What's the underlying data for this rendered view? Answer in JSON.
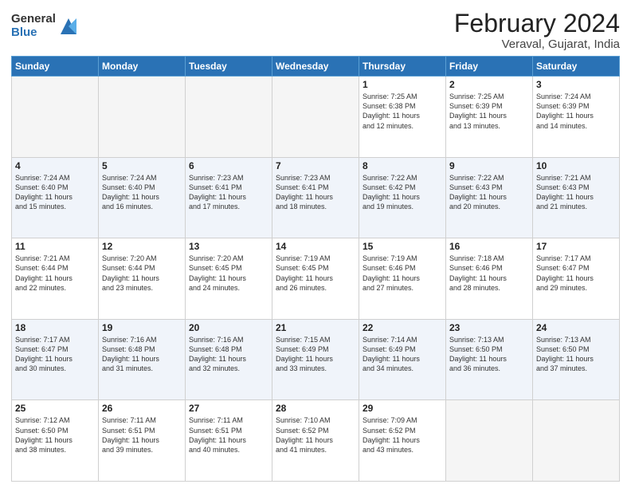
{
  "header": {
    "logo_general": "General",
    "logo_blue": "Blue",
    "month_title": "February 2024",
    "location": "Veraval, Gujarat, India"
  },
  "days_of_week": [
    "Sunday",
    "Monday",
    "Tuesday",
    "Wednesday",
    "Thursday",
    "Friday",
    "Saturday"
  ],
  "weeks": [
    [
      {
        "day": "",
        "info": ""
      },
      {
        "day": "",
        "info": ""
      },
      {
        "day": "",
        "info": ""
      },
      {
        "day": "",
        "info": ""
      },
      {
        "day": "1",
        "info": "Sunrise: 7:25 AM\nSunset: 6:38 PM\nDaylight: 11 hours\nand 12 minutes."
      },
      {
        "day": "2",
        "info": "Sunrise: 7:25 AM\nSunset: 6:39 PM\nDaylight: 11 hours\nand 13 minutes."
      },
      {
        "day": "3",
        "info": "Sunrise: 7:24 AM\nSunset: 6:39 PM\nDaylight: 11 hours\nand 14 minutes."
      }
    ],
    [
      {
        "day": "4",
        "info": "Sunrise: 7:24 AM\nSunset: 6:40 PM\nDaylight: 11 hours\nand 15 minutes."
      },
      {
        "day": "5",
        "info": "Sunrise: 7:24 AM\nSunset: 6:40 PM\nDaylight: 11 hours\nand 16 minutes."
      },
      {
        "day": "6",
        "info": "Sunrise: 7:23 AM\nSunset: 6:41 PM\nDaylight: 11 hours\nand 17 minutes."
      },
      {
        "day": "7",
        "info": "Sunrise: 7:23 AM\nSunset: 6:41 PM\nDaylight: 11 hours\nand 18 minutes."
      },
      {
        "day": "8",
        "info": "Sunrise: 7:22 AM\nSunset: 6:42 PM\nDaylight: 11 hours\nand 19 minutes."
      },
      {
        "day": "9",
        "info": "Sunrise: 7:22 AM\nSunset: 6:43 PM\nDaylight: 11 hours\nand 20 minutes."
      },
      {
        "day": "10",
        "info": "Sunrise: 7:21 AM\nSunset: 6:43 PM\nDaylight: 11 hours\nand 21 minutes."
      }
    ],
    [
      {
        "day": "11",
        "info": "Sunrise: 7:21 AM\nSunset: 6:44 PM\nDaylight: 11 hours\nand 22 minutes."
      },
      {
        "day": "12",
        "info": "Sunrise: 7:20 AM\nSunset: 6:44 PM\nDaylight: 11 hours\nand 23 minutes."
      },
      {
        "day": "13",
        "info": "Sunrise: 7:20 AM\nSunset: 6:45 PM\nDaylight: 11 hours\nand 24 minutes."
      },
      {
        "day": "14",
        "info": "Sunrise: 7:19 AM\nSunset: 6:45 PM\nDaylight: 11 hours\nand 26 minutes."
      },
      {
        "day": "15",
        "info": "Sunrise: 7:19 AM\nSunset: 6:46 PM\nDaylight: 11 hours\nand 27 minutes."
      },
      {
        "day": "16",
        "info": "Sunrise: 7:18 AM\nSunset: 6:46 PM\nDaylight: 11 hours\nand 28 minutes."
      },
      {
        "day": "17",
        "info": "Sunrise: 7:17 AM\nSunset: 6:47 PM\nDaylight: 11 hours\nand 29 minutes."
      }
    ],
    [
      {
        "day": "18",
        "info": "Sunrise: 7:17 AM\nSunset: 6:47 PM\nDaylight: 11 hours\nand 30 minutes."
      },
      {
        "day": "19",
        "info": "Sunrise: 7:16 AM\nSunset: 6:48 PM\nDaylight: 11 hours\nand 31 minutes."
      },
      {
        "day": "20",
        "info": "Sunrise: 7:16 AM\nSunset: 6:48 PM\nDaylight: 11 hours\nand 32 minutes."
      },
      {
        "day": "21",
        "info": "Sunrise: 7:15 AM\nSunset: 6:49 PM\nDaylight: 11 hours\nand 33 minutes."
      },
      {
        "day": "22",
        "info": "Sunrise: 7:14 AM\nSunset: 6:49 PM\nDaylight: 11 hours\nand 34 minutes."
      },
      {
        "day": "23",
        "info": "Sunrise: 7:13 AM\nSunset: 6:50 PM\nDaylight: 11 hours\nand 36 minutes."
      },
      {
        "day": "24",
        "info": "Sunrise: 7:13 AM\nSunset: 6:50 PM\nDaylight: 11 hours\nand 37 minutes."
      }
    ],
    [
      {
        "day": "25",
        "info": "Sunrise: 7:12 AM\nSunset: 6:50 PM\nDaylight: 11 hours\nand 38 minutes."
      },
      {
        "day": "26",
        "info": "Sunrise: 7:11 AM\nSunset: 6:51 PM\nDaylight: 11 hours\nand 39 minutes."
      },
      {
        "day": "27",
        "info": "Sunrise: 7:11 AM\nSunset: 6:51 PM\nDaylight: 11 hours\nand 40 minutes."
      },
      {
        "day": "28",
        "info": "Sunrise: 7:10 AM\nSunset: 6:52 PM\nDaylight: 11 hours\nand 41 minutes."
      },
      {
        "day": "29",
        "info": "Sunrise: 7:09 AM\nSunset: 6:52 PM\nDaylight: 11 hours\nand 43 minutes."
      },
      {
        "day": "",
        "info": ""
      },
      {
        "day": "",
        "info": ""
      }
    ]
  ]
}
